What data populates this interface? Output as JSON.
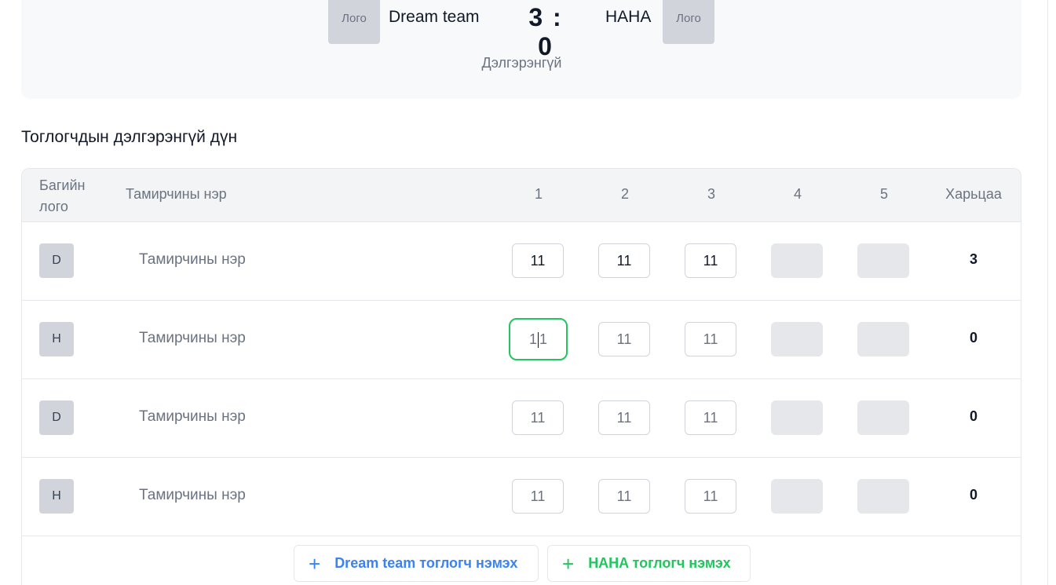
{
  "match": {
    "home_logo": "Лого",
    "home_team": "Dream team",
    "score": "3 : 0",
    "away_team": "HAHA",
    "away_logo": "Лого",
    "details_label": "Дэлгэрэнгүй"
  },
  "section_title": "Тоглогчдын дэлгэрэнгүй дүн",
  "table": {
    "headers": {
      "logo": "Багийн лого",
      "name": "Тамирчины нэр",
      "sets": [
        "1",
        "2",
        "3",
        "4",
        "5"
      ],
      "total": "Харьцаа"
    },
    "rows": [
      {
        "badge": "D",
        "name": "Тамирчины нэр",
        "sets": [
          "11",
          "11",
          "11",
          "",
          ""
        ],
        "total": "3"
      },
      {
        "badge": "H",
        "name": "Тамирчины нэр",
        "sets": [
          "11",
          "11",
          "11",
          "",
          ""
        ],
        "total": "0",
        "focused_set": 0
      },
      {
        "badge": "D",
        "name": "Тамирчины нэр",
        "sets": [
          "11",
          "11",
          "11",
          "",
          ""
        ],
        "total": "0"
      },
      {
        "badge": "H",
        "name": "Тамирчины нэр",
        "sets": [
          "11",
          "11",
          "11",
          "",
          ""
        ],
        "total": "0"
      }
    ]
  },
  "actions": {
    "add_home_player": "Dream team тоглогч нэмэх",
    "add_away_player": "HAHA тоглогч нэмэх"
  },
  "colors": {
    "focus": "#22c55e",
    "home_accent": "#3b82f6",
    "away_accent": "#22c55e"
  }
}
